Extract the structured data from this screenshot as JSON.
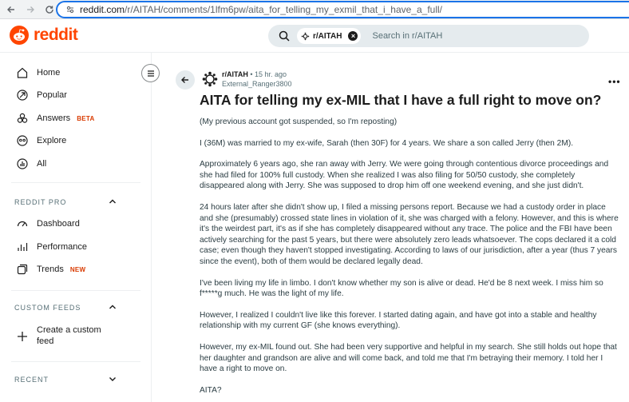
{
  "browser": {
    "url_host": "reddit.com",
    "url_path": "/r/AITAH/comments/1lfm6pw/aita_for_telling_my_exmil_that_i_have_a_full/"
  },
  "header": {
    "logo_text": "reddit",
    "search_chip": "r/AITAH",
    "search_placeholder": "Search in r/AITAH"
  },
  "sidebar": {
    "nav": [
      {
        "label": "Home",
        "icon": "home-icon"
      },
      {
        "label": "Popular",
        "icon": "popular-icon"
      },
      {
        "label": "Answers",
        "icon": "answers-icon",
        "badge": "BETA"
      },
      {
        "label": "Explore",
        "icon": "explore-icon"
      },
      {
        "label": "All",
        "icon": "all-icon"
      }
    ],
    "pro_title": "REDDIT PRO",
    "pro": [
      {
        "label": "Dashboard",
        "icon": "dashboard-icon"
      },
      {
        "label": "Performance",
        "icon": "performance-icon"
      },
      {
        "label": "Trends",
        "icon": "trends-icon",
        "badge": "NEW"
      }
    ],
    "feeds_title": "CUSTOM FEEDS",
    "create_feed_line1": "Create a custom",
    "create_feed_line2": "feed",
    "recent_title": "RECENT"
  },
  "post": {
    "subreddit": "r/AITAH",
    "separator": " • ",
    "time_ago": "15 hr. ago",
    "author": "External_Ranger3800",
    "more": "•••",
    "title": "AITA for telling my ex-MIL that I have a full right to move on?",
    "paragraphs": [
      "(My previous account got suspended, so I'm reposting)",
      "I (36M) was married to my ex-wife, Sarah (then 30F) for 4 years. We share a son called Jerry (then 2M).",
      "Approximately 6 years ago, she ran away with Jerry. We were going through contentious divorce proceedings and she had filed for 100% full custody. When she realized I was also filing for 50/50 custody, she completely disappeared along with Jerry. She was supposed to drop him off one weekend evening, and she just didn't.",
      "24 hours later after she didn't show up, I filed a missing persons report. Because we had a custody order in place and she (presumably) crossed state lines in violation of it, she was charged with a felony. However, and this is where it's the weirdest part, it's as if she has completely disappeared without any trace. The police and the FBI have been actively searching for the past 5 years, but there were absolutely zero leads whatsoever. The cops declared it a cold case; even though they haven't stopped investigating. According to laws of our jurisdiction, after a year (thus 7 years since the event), both of them would be declared legally dead.",
      "I've been living my life in limbo. I don't know whether my son is alive or dead. He'd be 8 next week. I miss him so f*****g much. He was the light of my life.",
      "However, I realized I couldn't live like this forever. I started dating again, and have got into a stable and healthy relationship with my current GF (she knows everything).",
      "However, my ex-MIL found out. She had been very supportive and helpful in my search. She still holds out hope that her daughter and grandson are alive and will come back, and told me that I'm betraying their memory. I told her I have a right to move on.",
      "AITA?"
    ]
  },
  "colors": {
    "brand": "#ff4500",
    "badge": "#d93a00",
    "url_focus": "#1a73e8"
  }
}
